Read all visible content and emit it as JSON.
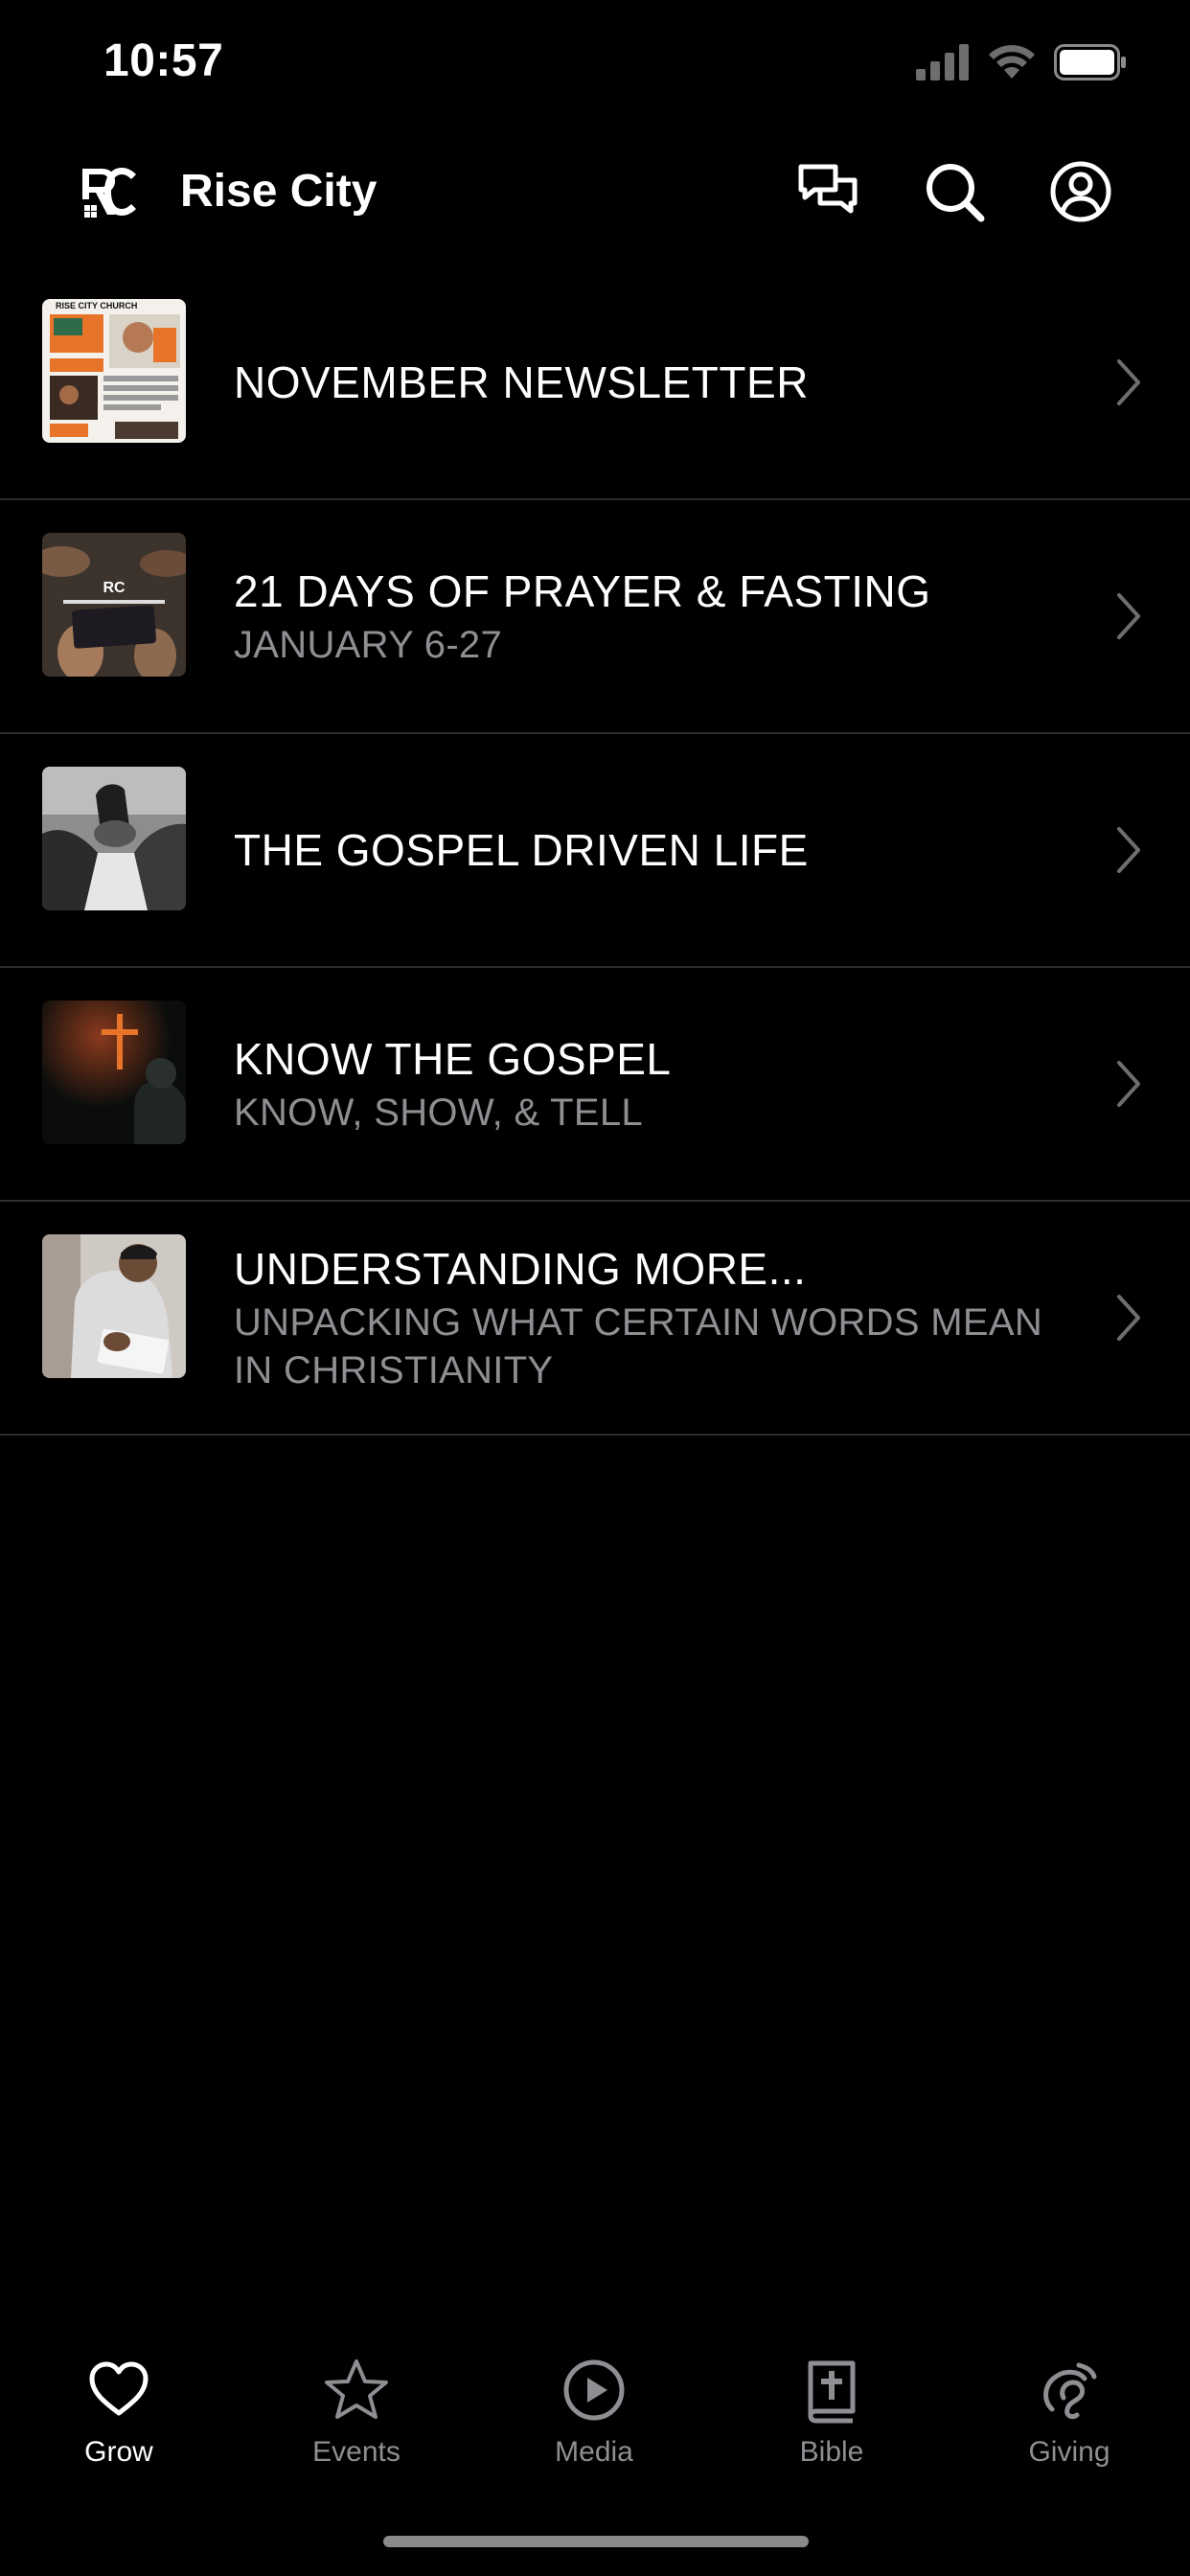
{
  "status_bar": {
    "time": "10:57"
  },
  "header": {
    "title": "Rise City"
  },
  "items": [
    {
      "title": "NOVEMBER NEWSLETTER",
      "subtitle": "",
      "thumb_text": "RISE CITY CHURCH"
    },
    {
      "title": "21 DAYS OF PRAYER & FASTING",
      "subtitle": "JANUARY 6-27"
    },
    {
      "title": "THE GOSPEL DRIVEN LIFE",
      "subtitle": ""
    },
    {
      "title": "KNOW THE GOSPEL",
      "subtitle": "KNOW, SHOW, & TELL"
    },
    {
      "title": "UNDERSTANDING MORE...",
      "subtitle": "UNPACKING WHAT CERTAIN WORDS MEAN IN CHRISTIANITY"
    }
  ],
  "tabs": [
    {
      "label": "Grow",
      "icon": "heart-icon",
      "active": true
    },
    {
      "label": "Events",
      "icon": "star-icon",
      "active": false
    },
    {
      "label": "Media",
      "icon": "play-circle-icon",
      "active": false
    },
    {
      "label": "Bible",
      "icon": "bible-icon",
      "active": false
    },
    {
      "label": "Giving",
      "icon": "giving-icon",
      "active": false
    }
  ],
  "colors": {
    "background": "#000000",
    "text": "#ffffff",
    "secondary_text": "#8e8e93",
    "accent": "#e8742a"
  }
}
